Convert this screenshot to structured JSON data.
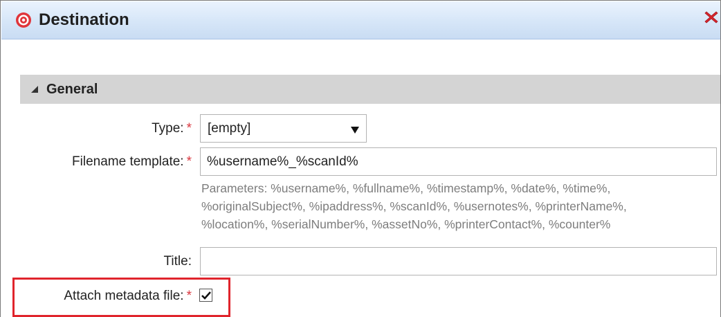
{
  "dialog": {
    "title": "Destination",
    "title_icon": "target-icon",
    "close_icon": "close-icon",
    "accent_close": "#d7262e"
  },
  "section": {
    "title": "General",
    "expanded": true
  },
  "form": {
    "type": {
      "label": "Type:",
      "required": "*",
      "value": "[empty]"
    },
    "filename_template": {
      "label": "Filename template:",
      "required": "*",
      "value": "%username%_%scanId%",
      "parameters": [
        "Parameters: %username%, %fullname%, %timestamp%, %date%, %time%,",
        "%originalSubject%, %ipaddress%, %scanId%, %usernotes%, %printerName%,",
        "%location%, %serialNumber%, %assetNo%, %printerContact%, %counter%"
      ]
    },
    "title": {
      "label": "Title:",
      "value": ""
    },
    "attach_metadata": {
      "label": "Attach metadata file:",
      "required": "*",
      "checked": true
    }
  },
  "colors": {
    "required_marker": "#d9363e",
    "highlight": "#e0242c",
    "section_bg": "#d4d4d4"
  }
}
